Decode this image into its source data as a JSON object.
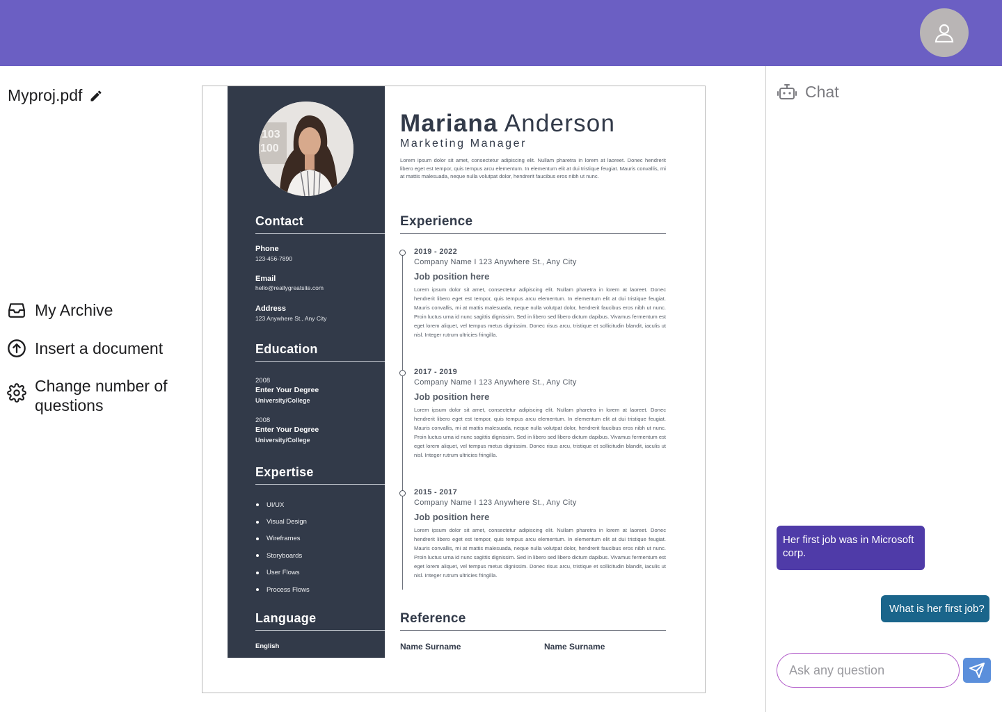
{
  "header": {
    "avatar_icon": "user-icon"
  },
  "file": {
    "name": "Myproj.pdf",
    "edit_icon": "pencil-icon"
  },
  "nav": {
    "items": [
      {
        "label": "My Archive",
        "icon": "inbox-icon"
      },
      {
        "label": "Insert a document",
        "icon": "cloud-upload-icon"
      },
      {
        "label": "Change number of questions",
        "icon": "gear-icon"
      }
    ]
  },
  "resume": {
    "first_name": "Mariana",
    "last_name": "Anderson",
    "role": "Marketing Manager",
    "intro": "Lorem ipsum dolor sit amet, consectetur adipiscing elit. Nullam pharetra in lorem at laoreet. Donec hendrerit libero eget est tempor, quis tempus arcu elementum. In elementum elit at dui tristique feugiat. Mauris convallis, mi at mattis malesuada, neque nulla volutpat dolor, hendrerit faucibus eros nibh ut nunc.",
    "contact": {
      "heading": "Contact",
      "phone_label": "Phone",
      "phone": "123-456-7890",
      "email_label": "Email",
      "email": "hello@reallygreatsite.com",
      "address_label": "Address",
      "address": "123 Anywhere St., Any City"
    },
    "education": {
      "heading": "Education",
      "entries": [
        {
          "year": "2008",
          "degree": "Enter Your Degree",
          "school": "University/College"
        },
        {
          "year": "2008",
          "degree": "Enter Your Degree",
          "school": "University/College"
        }
      ]
    },
    "expertise": {
      "heading": "Expertise",
      "items": [
        "UI/UX",
        "Visual Design",
        "Wireframes",
        "Storyboards",
        "User Flows",
        "Process Flows"
      ]
    },
    "language": {
      "heading": "Language",
      "items": [
        "English"
      ]
    },
    "experience": {
      "heading": "Experience",
      "jobs": [
        {
          "years": "2019 - 2022",
          "company": "Company Name I 123 Anywhere St., Any City",
          "position": "Job position here",
          "desc": "Lorem ipsum dolor sit amet, consectetur adipiscing elit. Nullam pharetra in lorem at laoreet. Donec hendrerit libero eget est tempor, quis tempus arcu elementum. In elementum elit at dui tristique feugiat. Mauris convallis, mi at mattis malesuada, neque nulla volutpat dolor, hendrerit faucibus eros nibh ut nunc. Proin luctus urna id nunc sagittis dignissim. Sed in libero sed libero dictum dapibus. Vivamus fermentum est eget lorem aliquet, vel tempus metus dignissim. Donec risus arcu, tristique et sollicitudin blandit, iaculis ut nisl. Integer rutrum ultricies fringilla."
        },
        {
          "years": "2017 - 2019",
          "company": "Company Name I 123 Anywhere St., Any City",
          "position": "Job position here",
          "desc": "Lorem ipsum dolor sit amet, consectetur adipiscing elit. Nullam pharetra in lorem at laoreet. Donec hendrerit libero eget est tempor, quis tempus arcu elementum. In elementum elit at dui tristique feugiat. Mauris convallis, mi at mattis malesuada, neque nulla volutpat dolor, hendrerit faucibus eros nibh ut nunc. Proin luctus urna id nunc sagittis dignissim. Sed in libero sed libero dictum dapibus. Vivamus fermentum est eget lorem aliquet, vel tempus metus dignissim. Donec risus arcu, tristique et sollicitudin blandit, iaculis ut nisl. Integer rutrum ultricies fringilla."
        },
        {
          "years": "2015 - 2017",
          "company": "Company Name I 123 Anywhere St., Any City",
          "position": "Job position here",
          "desc": "Lorem ipsum dolor sit amet, consectetur adipiscing elit. Nullam pharetra in lorem at laoreet. Donec hendrerit libero eget est tempor, quis tempus arcu elementum. In elementum elit at dui tristique feugiat. Mauris convallis, mi at mattis malesuada, neque nulla volutpat dolor, hendrerit faucibus eros nibh ut nunc. Proin luctus urna id nunc sagittis dignissim. Sed in libero sed libero dictum dapibus. Vivamus fermentum est eget lorem aliquet, vel tempus metus dignissim. Donec risus arcu, tristique et sollicitudin blandit, iaculis ut nisl. Integer rutrum ultricies fringilla."
        }
      ]
    },
    "reference": {
      "heading": "Reference",
      "names": [
        "Name Surname",
        "Name Surname"
      ]
    }
  },
  "chat": {
    "title": "Chat",
    "icon": "robot-icon",
    "messages": [
      {
        "from": "bot",
        "text": "Her first job was in Microsoft corp."
      },
      {
        "from": "user",
        "text": "What is her first job?"
      }
    ],
    "input_placeholder": "Ask any question",
    "send_icon": "send-icon"
  },
  "colors": {
    "header": "#6b5fc3",
    "resume_sidebar": "#323a49",
    "bot_bubble": "#4f3ba8",
    "user_bubble": "#1a658b",
    "input_border": "#b05ac9",
    "send_button": "#5b8fdb"
  }
}
